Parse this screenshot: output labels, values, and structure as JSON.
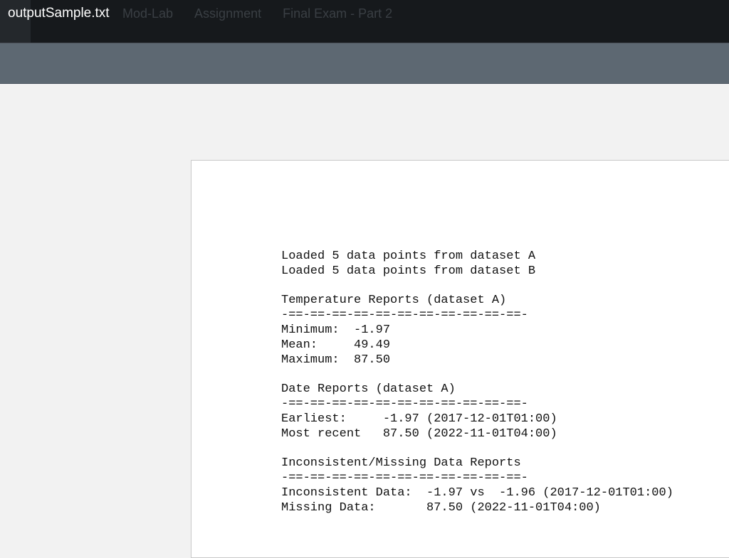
{
  "window": {
    "file_title": "outputSample.txt",
    "breadcrumb": [
      "Mod-Lab",
      "Assignment",
      "Final Exam - Part 2"
    ]
  },
  "document": {
    "lines": [
      "Loaded 5 data points from dataset A",
      "Loaded 5 data points from dataset B",
      "",
      "Temperature Reports (dataset A)",
      "-==-==-==-==-==-==-==-==-==-==-==-",
      "Minimum:  -1.97",
      "Mean:     49.49",
      "Maximum:  87.50",
      "",
      "Date Reports (dataset A)",
      "-==-==-==-==-==-==-==-==-==-==-==-",
      "Earliest:     -1.97 (2017-12-01T01:00)",
      "Most recent   87.50 (2022-11-01T04:00)",
      "",
      "Inconsistent/Missing Data Reports",
      "-==-==-==-==-==-==-==-==-==-==-==-",
      "Inconsistent Data:  -1.97 vs  -1.96 (2017-12-01T01:00)",
      "Missing Data:       87.50 (2022-11-01T04:00)"
    ]
  }
}
